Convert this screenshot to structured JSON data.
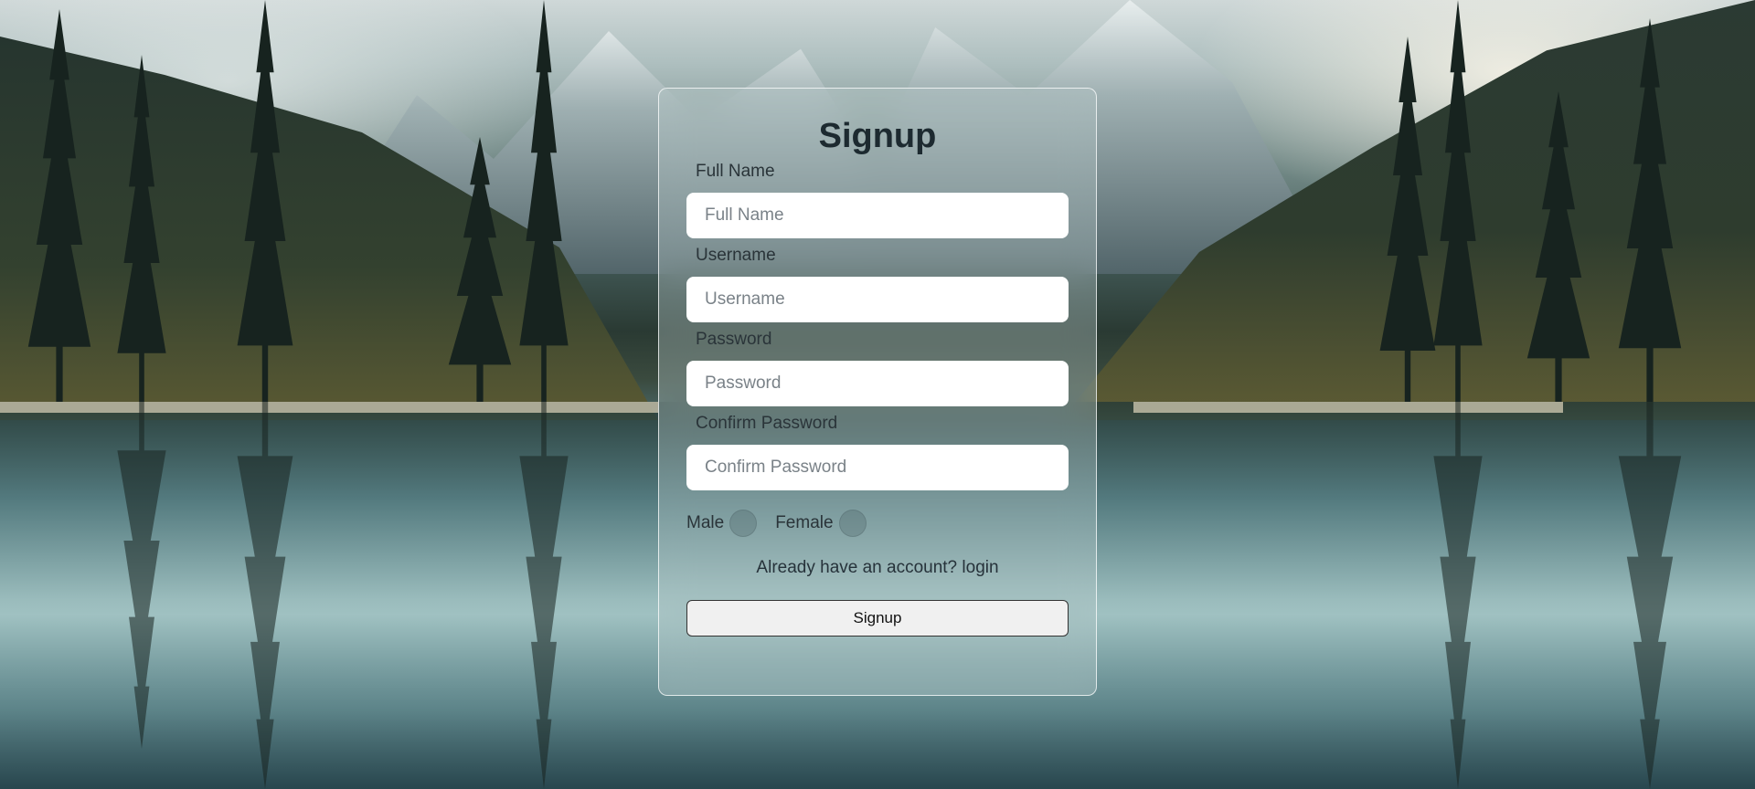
{
  "form": {
    "title": "Signup",
    "fields": [
      {
        "label": "Full Name",
        "placeholder": "Full Name",
        "value": ""
      },
      {
        "label": "Username",
        "placeholder": "Username",
        "value": ""
      },
      {
        "label": "Password",
        "placeholder": "Password",
        "value": ""
      },
      {
        "label": "Confirm Password",
        "placeholder": "Confirm Password",
        "value": ""
      }
    ],
    "gender": {
      "options": [
        "Male",
        "Female"
      ],
      "selected": null
    },
    "login_prompt": "Already have an account?",
    "login_link": "login",
    "submit_label": "Signup"
  },
  "colors": {
    "title": "#1d2a30",
    "card_border": "#ffffff",
    "input_bg": "#ffffff",
    "button_bg": "#f0f0f0"
  }
}
